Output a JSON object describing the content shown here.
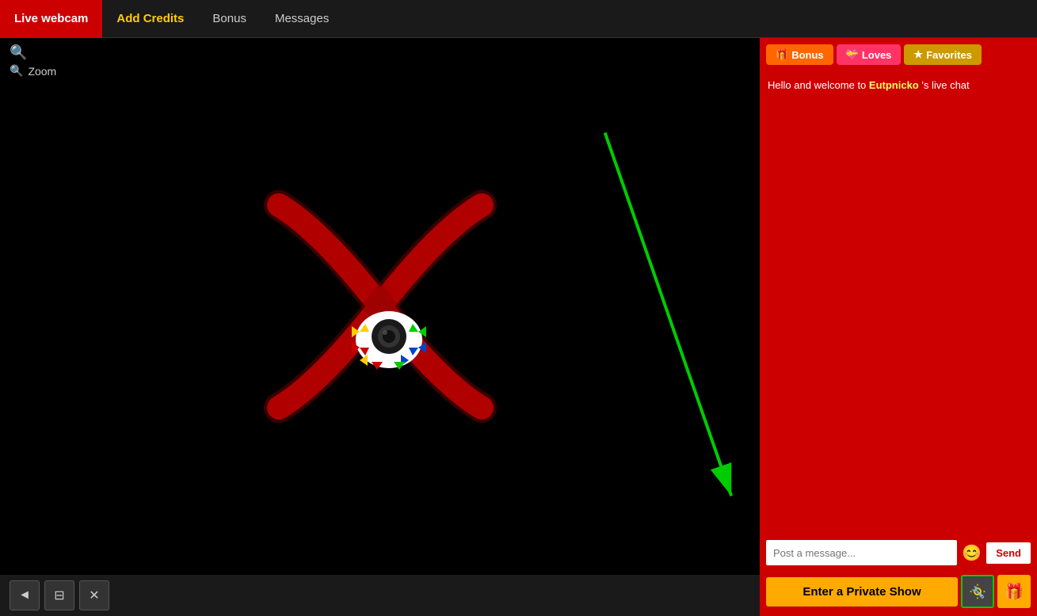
{
  "nav": {
    "items": [
      {
        "id": "live-webcam",
        "label": "Live webcam",
        "active": true,
        "highlight": false
      },
      {
        "id": "add-credits",
        "label": "Add Credits",
        "active": false,
        "highlight": true
      },
      {
        "id": "bonus",
        "label": "Bonus",
        "active": false,
        "highlight": false
      },
      {
        "id": "messages",
        "label": "Messages",
        "active": false,
        "highlight": false
      }
    ]
  },
  "controls": {
    "zoom_label": "Zoom",
    "bottom_buttons": [
      "◄",
      "⊞",
      "✕"
    ]
  },
  "chat": {
    "header_buttons": [
      {
        "id": "bonus",
        "icon": "🎁",
        "label": "Bonus"
      },
      {
        "id": "loves",
        "icon": "💝",
        "label": "Loves"
      },
      {
        "id": "favorites",
        "icon": "★",
        "label": "Favorites"
      }
    ],
    "welcome_text_prefix": "Hello and welcome to ",
    "username": "Eutpnicko",
    "welcome_text_suffix": " 's live chat",
    "input_placeholder": "Post a message...",
    "send_label": "Send",
    "private_show_label": "Enter a Private Show"
  },
  "colors": {
    "active_nav": "#cc0000",
    "highlight_nav": "#ffcc00",
    "sidebar_bg": "#cc0000",
    "private_btn": "#ffaa00",
    "arrow_color": "#00cc00"
  }
}
